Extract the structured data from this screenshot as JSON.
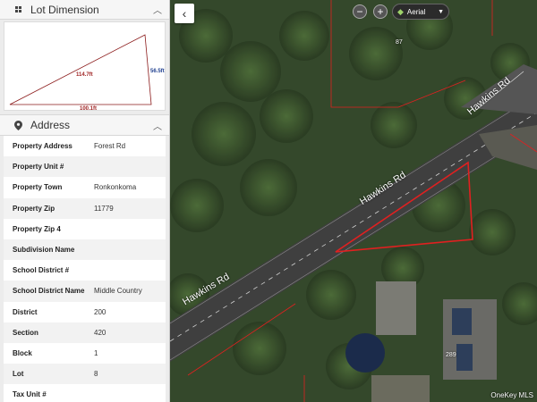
{
  "lot_dimension": {
    "title": "Lot Dimension",
    "side_hypotenuse": "114.7ft",
    "side_right": "56.5ft",
    "side_bottom": "100.1ft"
  },
  "address": {
    "title": "Address",
    "rows": [
      {
        "label": "Property Address",
        "value": "Forest Rd"
      },
      {
        "label": "Property Unit #",
        "value": ""
      },
      {
        "label": "Property Town",
        "value": "Ronkonkoma"
      },
      {
        "label": "Property Zip",
        "value": "11779"
      },
      {
        "label": "Property Zip 4",
        "value": ""
      },
      {
        "label": "Subdivision Name",
        "value": ""
      },
      {
        "label": "School District #",
        "value": ""
      },
      {
        "label": "School District Name",
        "value": "Middle Country"
      },
      {
        "label": "District",
        "value": "200"
      },
      {
        "label": "Section",
        "value": "420"
      },
      {
        "label": "Block",
        "value": "1"
      },
      {
        "label": "Lot",
        "value": "8"
      },
      {
        "label": "Tax Unit #",
        "value": ""
      }
    ]
  },
  "map": {
    "collapse_icon": "‹",
    "zoom_out": "−",
    "zoom_in": "+",
    "layer": "Aerial",
    "road_label_1": "Hawkins Rd",
    "road_label_2": "Hawkins Rd",
    "road_label_3": "Hawkins Rd",
    "parcel_87": "87",
    "parcel_289": "289",
    "watermark": "OneKey MLS"
  },
  "colors": {
    "parcel_outline": "#e02020",
    "lot_outline": "#8b1a1a",
    "road": "#3f3f3f"
  }
}
